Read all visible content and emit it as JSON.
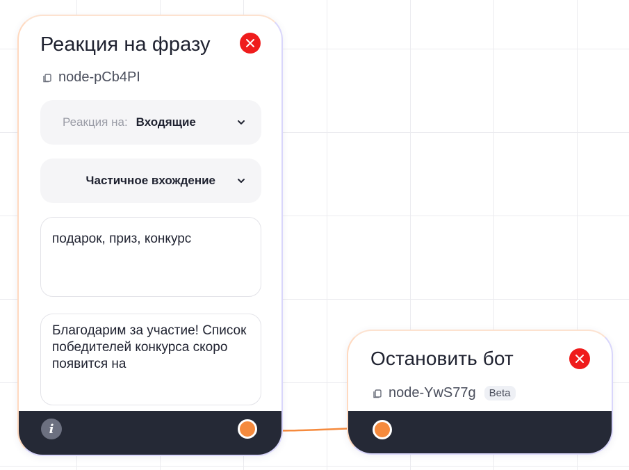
{
  "colors": {
    "accent": "#f58a3d",
    "close": "#ef1c1c",
    "footer": "#252936",
    "edge": "#f58a3d"
  },
  "nodes": [
    {
      "title": "Реакция на фразу",
      "id": "node-pCb4PI",
      "reaction_label": "Реакция на:",
      "reaction_value": "Входящие",
      "match_mode": "Частичное вхождение",
      "keywords": "подарок, приз, конкурс",
      "reply": "Благодарим за участие! Список победителей конкурса скоро появится на",
      "info_icon": "i"
    },
    {
      "title": "Остановить бот",
      "id": "node-YwS77g",
      "badge": "Beta"
    }
  ],
  "icons": [
    "close-icon",
    "copy-icon",
    "chevron-down-icon",
    "info-icon",
    "connection-port"
  ]
}
